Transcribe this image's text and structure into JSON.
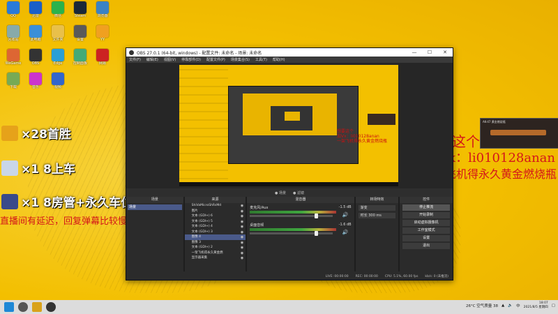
{
  "desktop": {
    "icons": [
      {
        "label": "QQ",
        "color": "#2a7ad8"
      },
      {
        "label": "迅雷",
        "color": "#1a5fc8"
      },
      {
        "label": "微信",
        "color": "#2bb24c"
      },
      {
        "label": "Steam",
        "color": "#1b2838"
      },
      {
        "label": "浏览器",
        "color": "#3b82c4"
      },
      {
        "label": "回收站",
        "color": "#8aa"
      },
      {
        "label": "此电脑",
        "color": "#3a8fd8"
      },
      {
        "label": "文件夹",
        "color": "#e9c04a"
      },
      {
        "label": "设置",
        "color": "#5a5a5a"
      },
      {
        "label": "YY",
        "color": "#f0a020"
      },
      {
        "label": "WeGame",
        "color": "#d63"
      },
      {
        "label": "OBS",
        "color": "#333"
      },
      {
        "label": "Edge",
        "color": "#2a9fd6"
      },
      {
        "label": "控制面板",
        "color": "#4a7"
      },
      {
        "label": "网易",
        "color": "#c22"
      },
      {
        "label": "下载",
        "color": "#7a5"
      },
      {
        "label": "音乐",
        "color": "#c3c"
      },
      {
        "label": "视频",
        "color": "#36c"
      }
    ]
  },
  "overlay": {
    "rows": [
      {
        "text": "×28首胜",
        "thumb_color": "#e6a21a"
      },
      {
        "text": "×1 8上车",
        "thumb_color": "#c9d6e8"
      },
      {
        "text": "×1 8房管+永久车位",
        "thumb_color": "#3a4a8a"
      }
    ],
    "notice": "直播间有延迟，回复弹幕比较慢",
    "promo": {
      "line1": "想要这个",
      "line2": "加Vx：li010128anan",
      "line3": "一架飞机得永久黄金燃烧瓶"
    },
    "gun_tag": "AK-47 黄金燃烧瓶"
  },
  "obs": {
    "title": "OBS 27.0.1 (64-bit, windows) - 配置文件: 未命名 - 场景: 未命名",
    "menu": [
      "文件(F)",
      "编辑(E)",
      "视图(V)",
      "停靠部件(D)",
      "配置文件(P)",
      "场景集合(S)",
      "工具(T)",
      "帮助(H)"
    ],
    "scene_controls": [
      "● 场景",
      "● 滤镜"
    ],
    "docks": {
      "scenes": {
        "title": "场景",
        "items": [
          "场景"
        ]
      },
      "sources": {
        "title": "来源",
        "items": [
          "ShiVaMicroShRsMd",
          "图片",
          "文本 (GDI+) 6",
          "文本 (GDI+) 5",
          "文本 (GDI+) 4",
          "文本 (GDI+) 3",
          "图像 4",
          "图像 3",
          "文本 (GDI+) 2",
          "一架飞机得永久黄金燃",
          "显示器采集"
        ]
      },
      "mixer": {
        "title": "混音器",
        "channels": [
          {
            "name": "麦克风/Aux",
            "db": "-1.5 dB"
          },
          {
            "name": "桌面音频",
            "db": "-1.6 dB"
          }
        ]
      },
      "transitions": {
        "title": "转场特效",
        "type": "渐变",
        "duration_label": "时长",
        "duration": "300 ms"
      },
      "controls": {
        "title": "控件",
        "buttons": [
          "停止推流",
          "开始录制",
          "启动虚拟摄像机",
          "工作室模式",
          "设置",
          "退出"
        ]
      }
    },
    "status": {
      "live": "LIVE: 00:00:00",
      "rec": "REC: 00:00:00",
      "cpu": "CPU: 5.1%, 60.00 fps",
      "kbps": "kb/s: 0 (未推流)"
    }
  },
  "taskbar": {
    "weather": "26°C 空气质量 38",
    "ime": "中",
    "time": "18:07",
    "date": "2021/8/5 星期四"
  }
}
